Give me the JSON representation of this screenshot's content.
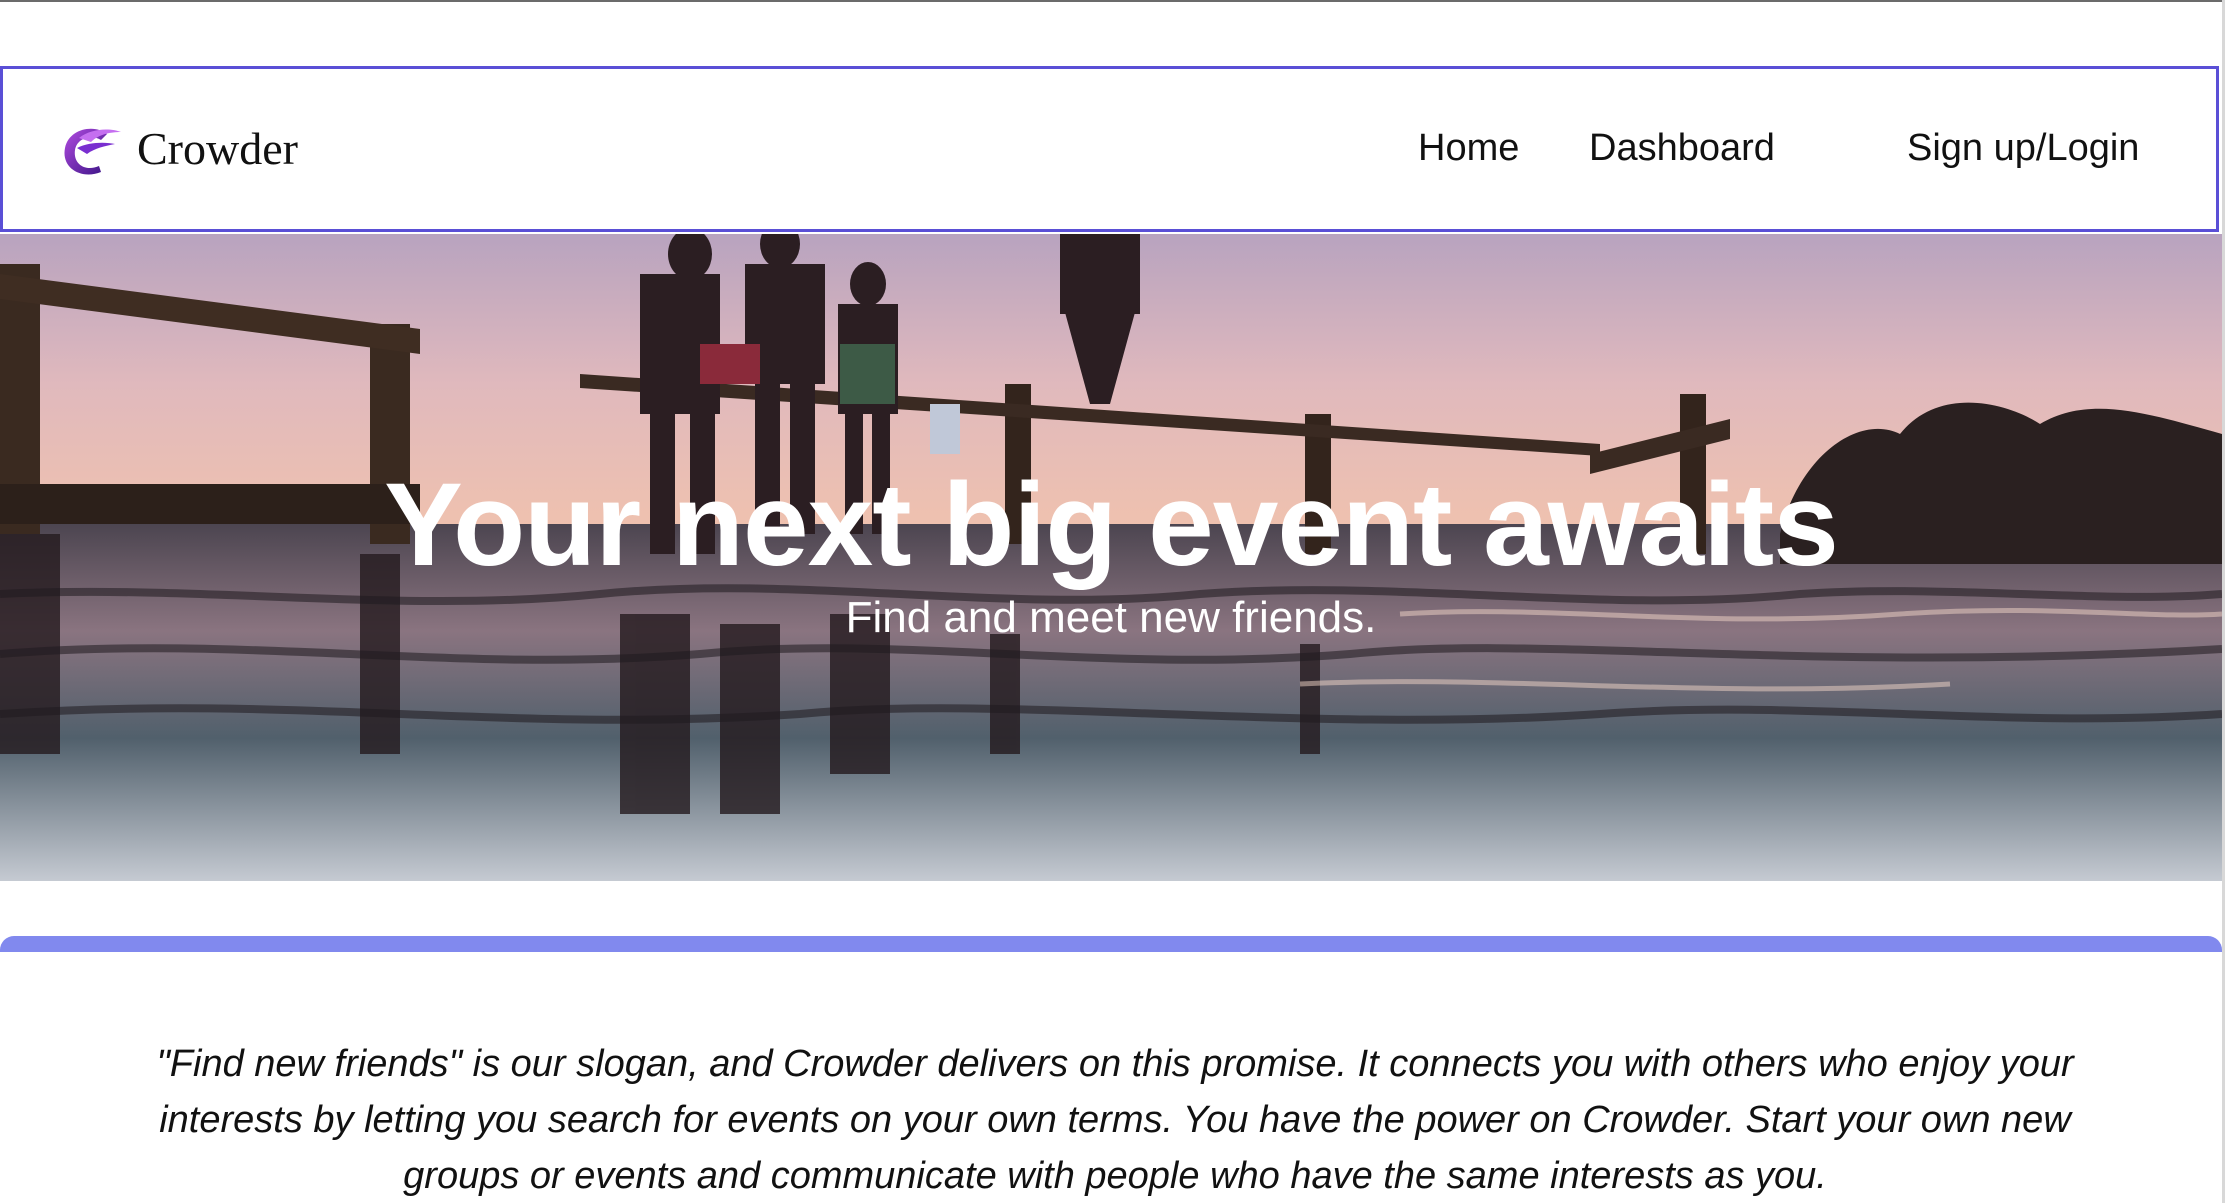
{
  "brand": {
    "name": "Crowder",
    "logo_icon": "crowder-c-logo-icon",
    "logo_color": "#6a2bb8"
  },
  "nav": {
    "home": "Home",
    "dashboard": "Dashboard",
    "login": "Sign up/Login",
    "border_color": "#5a4fd6"
  },
  "hero": {
    "title": "Your next big event awaits",
    "subtitle": "Find and meet new friends."
  },
  "accent_color": "#8189ee",
  "description": "\"Find new friends\" is our slogan, and Crowder delivers on this promise. It connects you with others who enjoy your interests by letting you search for events on your own terms. You have the power on Crowder. Start your own new groups or events and communicate with people who have the same interests as you."
}
